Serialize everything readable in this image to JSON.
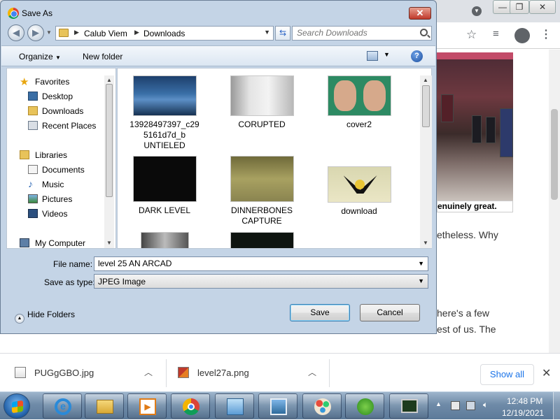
{
  "dialog": {
    "title": "Save As",
    "close_label": "✕",
    "address": {
      "segment1": "Calub Viem",
      "segment2": "Downloads"
    },
    "search_placeholder": "Search Downloads",
    "toolbar": {
      "organize": "Organize",
      "new_folder": "New folder"
    },
    "nav": {
      "items": [
        {
          "label": "Favorites",
          "icon": "star-icon"
        },
        {
          "label": "Desktop",
          "icon": "desktop-icon"
        },
        {
          "label": "Downloads",
          "icon": "downloads-folder-icon"
        },
        {
          "label": "Recent Places",
          "icon": "recent-places-icon"
        },
        {
          "label": "Libraries",
          "icon": "libraries-icon"
        },
        {
          "label": "Documents",
          "icon": "documents-icon"
        },
        {
          "label": "Music",
          "icon": "music-icon"
        },
        {
          "label": "Pictures",
          "icon": "pictures-icon"
        },
        {
          "label": "Videos",
          "icon": "videos-icon"
        },
        {
          "label": "My Computer",
          "icon": "computer-icon"
        }
      ]
    },
    "files": [
      {
        "name": "13928497397_c295161d7d_b UNTIELED",
        "line1": "13928497397_c29",
        "line2": "5161d7d_b",
        "line3": "UNTIELED"
      },
      {
        "name": "CORUPTED",
        "line1": "CORUPTED",
        "line2": "",
        "line3": ""
      },
      {
        "name": "cover2",
        "line1": "cover2",
        "line2": "",
        "line3": ""
      },
      {
        "name": "DARK LEVEL",
        "line1": "DARK LEVEL",
        "line2": "",
        "line3": ""
      },
      {
        "name": "DINNERBONES CAPTURE",
        "line1": "DINNERBONES",
        "line2": "CAPTURE",
        "line3": ""
      },
      {
        "name": "download",
        "line1": "download",
        "line2": "",
        "line3": ""
      }
    ],
    "file_name_label": "File name:",
    "file_name_value": "level 25 AN ARCAD",
    "save_type_label": "Save as type:",
    "save_type_value": "JPEG Image",
    "hide_folders": "Hide Folders",
    "save_button": "Save",
    "cancel_button": "Cancel"
  },
  "web": {
    "caption": "enuinely great.",
    "line1": "etheless. Why",
    "line2": "here's a few",
    "line3": "est of us. The"
  },
  "downloads": {
    "items": [
      {
        "name": "PUGgGBO.jpg"
      },
      {
        "name": "level27a.png"
      }
    ],
    "show_all": "Show all"
  },
  "taskbar": {
    "time": "12:48 PM",
    "date": "12/19/2021"
  },
  "colors": {
    "dialog_frame": "#c4d4e6",
    "chrome_tab_bg": "#dee1e6",
    "link_blue": "#1a73e8",
    "taskbar": "#6f8ba8"
  }
}
